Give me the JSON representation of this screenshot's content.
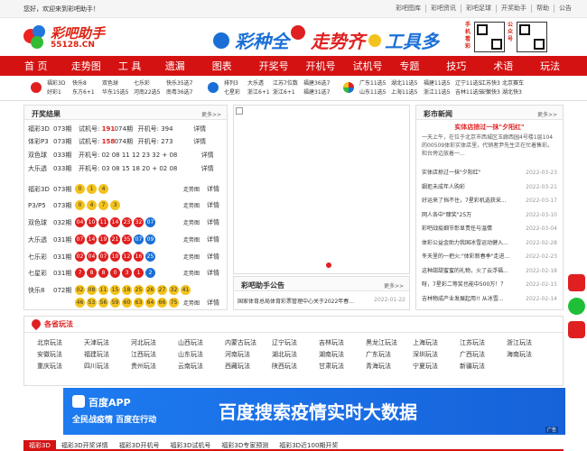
{
  "topbar": {
    "welcome": "您好，欢迎来到彩吧助手！",
    "links": [
      "彩吧图库",
      "彩吧资讯",
      "彩吧足球",
      "开奖助手",
      "帮助",
      "公告"
    ]
  },
  "logo": {
    "name": "彩吧助手",
    "url": "55128.CN"
  },
  "banner": {
    "slogan1": "彩种全",
    "slogan2": "走势齐",
    "slogan3": "工具多"
  },
  "qr": {
    "label1": "手机看彩",
    "label2": "公众号"
  },
  "nav": [
    "首 页",
    "走势图",
    "工 具",
    "遗漏",
    "图表",
    "开奖号",
    "开机号",
    "试机号",
    "专题",
    "技巧",
    "术语",
    "玩法"
  ],
  "subnav": {
    "g1": {
      "c1": [
        "福彩3D",
        "好彩1"
      ],
      "c2": [
        "快乐8",
        "东方6+1"
      ],
      "c3": [
        "双色球",
        "华东15选5"
      ],
      "c4": [
        "七乐彩",
        "河南22选5"
      ],
      "c5": [
        "快乐35选7",
        "南粤36选7"
      ]
    },
    "g2": {
      "c1": [
        "排列3",
        "七星彩"
      ],
      "c2": [
        "大乐透",
        "浙江6+1"
      ],
      "c3": [
        "江苏7位数",
        "浙江6+1"
      ],
      "c4": [
        "福建36选7",
        "福建31选7"
      ]
    },
    "g3": {
      "c1": [
        "广东11选5",
        "山东11选5"
      ],
      "c2": [
        "湖北11选5",
        "上海11选5"
      ],
      "c3": [
        "福建11选5",
        "浙江11选5"
      ],
      "c4": [
        "辽宁11选5",
        "吉林11选5"
      ],
      "c5": [
        "江苏快3",
        "安徽快3"
      ],
      "c6": [
        "北京赛车",
        "湖北快3"
      ]
    }
  },
  "results": {
    "title": "开奖结果",
    "more": "更多>>",
    "detail": "详情",
    "trend": "走势图",
    "summary": [
      {
        "game": "福彩3D",
        "issue": "073期",
        "label1": "试机号:",
        "val1": "191",
        "issue2": "074期",
        "label2": "开机号:",
        "val2": "394"
      },
      {
        "game": "体彩P3",
        "issue": "073期",
        "label1": "试机号:",
        "val1": "158",
        "issue2": "074期",
        "label2": "开机号:",
        "val2": "273"
      },
      {
        "game": "双色球",
        "issue": "033期",
        "label1": "开机号:",
        "val1": "02 08 11 12 23 32 + 08"
      },
      {
        "game": "大乐透",
        "issue": "033期",
        "label1": "开机号:",
        "val1": "03 08 15 18 20 + 02 08"
      }
    ],
    "draws": [
      {
        "game": "福彩3D",
        "issue": "073期",
        "balls": [
          {
            "n": "0",
            "c": "yellow"
          },
          {
            "n": "1",
            "c": "yellow"
          },
          {
            "n": "4",
            "c": "yellow"
          }
        ]
      },
      {
        "game": "P3/P5",
        "issue": "073期",
        "balls": [
          {
            "n": "0",
            "c": "yellow"
          },
          {
            "n": "4",
            "c": "yellow"
          },
          {
            "n": "7",
            "c": "yellow"
          },
          {
            "n": "3",
            "c": "yellow"
          }
        ]
      },
      {
        "game": "双色球",
        "issue": "032期",
        "balls": [
          {
            "n": "04",
            "c": "red"
          },
          {
            "n": "10",
            "c": "red"
          },
          {
            "n": "11",
            "c": "red"
          },
          {
            "n": "14",
            "c": "red"
          },
          {
            "n": "23",
            "c": "red"
          },
          {
            "n": "32",
            "c": "red"
          },
          {
            "n": "07",
            "c": "blue"
          }
        ]
      },
      {
        "game": "大乐透",
        "issue": "031期",
        "balls": [
          {
            "n": "07",
            "c": "red"
          },
          {
            "n": "14",
            "c": "red"
          },
          {
            "n": "19",
            "c": "red"
          },
          {
            "n": "21",
            "c": "red"
          },
          {
            "n": "35",
            "c": "red"
          },
          {
            "n": "07",
            "c": "blue"
          },
          {
            "n": "09",
            "c": "blue"
          }
        ]
      },
      {
        "game": "七乐彩",
        "issue": "031期",
        "balls": [
          {
            "n": "02",
            "c": "red"
          },
          {
            "n": "04",
            "c": "red"
          },
          {
            "n": "07",
            "c": "red"
          },
          {
            "n": "10",
            "c": "red"
          },
          {
            "n": "12",
            "c": "red"
          },
          {
            "n": "16",
            "c": "red"
          },
          {
            "n": "25",
            "c": "blue"
          }
        ]
      },
      {
        "game": "七星彩",
        "issue": "031期",
        "balls": [
          {
            "n": "7",
            "c": "red"
          },
          {
            "n": "8",
            "c": "red"
          },
          {
            "n": "8",
            "c": "red"
          },
          {
            "n": "0",
            "c": "red"
          },
          {
            "n": "3",
            "c": "red"
          },
          {
            "n": "1",
            "c": "red"
          },
          {
            "n": "2",
            "c": "blue"
          }
        ]
      },
      {
        "game": "快乐8",
        "issue": "072期",
        "balls": [
          {
            "n": "02",
            "c": "yellow"
          },
          {
            "n": "08",
            "c": "yellow"
          },
          {
            "n": "11",
            "c": "yellow"
          },
          {
            "n": "15",
            "c": "yellow"
          },
          {
            "n": "18",
            "c": "yellow"
          },
          {
            "n": "25",
            "c": "yellow"
          },
          {
            "n": "26",
            "c": "yellow"
          },
          {
            "n": "27",
            "c": "yellow"
          },
          {
            "n": "32",
            "c": "yellow"
          },
          {
            "n": "41",
            "c": "yellow"
          }
        ],
        "balls2": [
          {
            "n": "46",
            "c": "yellow"
          },
          {
            "n": "53",
            "c": "yellow"
          },
          {
            "n": "56",
            "c": "yellow"
          },
          {
            "n": "59",
            "c": "yellow"
          },
          {
            "n": "60",
            "c": "yellow"
          },
          {
            "n": "63",
            "c": "yellow"
          },
          {
            "n": "64",
            "c": "yellow"
          },
          {
            "n": "66",
            "c": "yellow"
          },
          {
            "n": "75",
            "c": "yellow"
          }
        ]
      }
    ]
  },
  "notice": {
    "title": "彩吧助手公告",
    "more": "更多>>",
    "item": "国家体育总局体育彩票管理中心关于2022年春...",
    "date": "2022-01-22"
  },
  "news": {
    "title": "彩市新闻",
    "more": "更多>>",
    "headline": "实体店掠过一抹\"夕阳红\"",
    "summary": "一天上午，在位于北京市西城区玉廊西园4号楼1层104的00509体彩实体店里，代销者尹先生正在忙着售彩。和台旁边放着一...",
    "items": [
      {
        "t": "实体店掠过一抹\"夕阳红\"",
        "d": "2022-03-23"
      },
      {
        "t": "姻拒未成年人购彩",
        "d": "2022-03-21"
      },
      {
        "t": "好运来了挡不住，7星彩机选获采...",
        "d": "2022-03-17"
      },
      {
        "t": "网人各中\"肆奖\"25万",
        "d": "2022-03-10"
      },
      {
        "t": "彩吧战疫细节彰显责任与温情",
        "d": "2022-03-04"
      },
      {
        "t": "体彩公益金助力我国冰雪运动健入...",
        "d": "2022-02-28"
      },
      {
        "t": "冬天里的一把火:\"体彩新春季\"走进...",
        "d": "2022-02-23"
      },
      {
        "t": "这种甜甜蜜蜜的礼物，火了云浮福...",
        "d": "2022-02-18"
      },
      {
        "t": "呀，7星彩二等奖也能中500万！？",
        "d": "2022-02-15"
      },
      {
        "t": "吉林物成产业发展起用!! 从冰雪...",
        "d": "2022-02-14"
      }
    ]
  },
  "provinces": {
    "title": "各省玩法",
    "items": [
      "北京玩法",
      "天津玩法",
      "河北玩法",
      "山西玩法",
      "内蒙古玩法",
      "辽宁玩法",
      "吉林玩法",
      "黑龙江玩法",
      "上海玩法",
      "江苏玩法",
      "浙江玩法",
      "安徽玩法",
      "福建玩法",
      "江西玩法",
      "山东玩法",
      "河南玩法",
      "湖北玩法",
      "湖南玩法",
      "广东玩法",
      "深圳玩法",
      "广西玩法",
      "海南玩法",
      "重庆玩法",
      "四川玩法",
      "贵州玩法",
      "云南玩法",
      "西藏玩法",
      "陕西玩法",
      "甘肃玩法",
      "青海玩法",
      "宁夏玩法",
      "新疆玩法"
    ]
  },
  "ad": {
    "app": "百度APP",
    "tag1": "全民战疫情 百度在行动",
    "headline": "百度搜索疫情实时大数据",
    "badge": "广告"
  },
  "bottomtabs": [
    "福彩3D",
    "福彩3D开奖详情",
    "福彩3D开机号",
    "福彩3D试机号",
    "福彩3D专家预测",
    "福彩3D近100期开奖"
  ],
  "colors": {
    "brand": "#d41212",
    "red": "#e02020",
    "blue": "#1a6fd6",
    "yellow": "#f4c21d"
  }
}
